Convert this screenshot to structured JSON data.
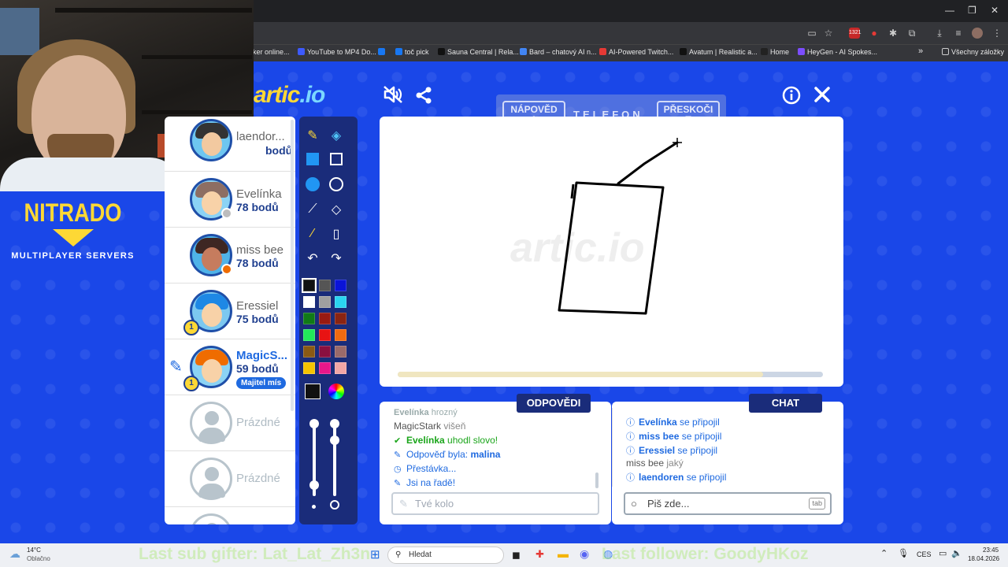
{
  "browser": {
    "bookmarks": [
      {
        "label": "aker online...",
        "color": "#ffffff"
      },
      {
        "label": "YouTube to MP4 Do...",
        "color": "#3d5afe"
      },
      {
        "label": "",
        "color": "#1877f2"
      },
      {
        "label": "toč pick",
        "color": "#1877f2"
      },
      {
        "label": "Sauna Central | Rela...",
        "color": "#111111"
      },
      {
        "label": "Bard – chatový AI n...",
        "color": "#4285f4"
      },
      {
        "label": "AI-Powered Twitch...",
        "color": "#e53935"
      },
      {
        "label": "Avatum | Realistic a...",
        "color": "#111111"
      },
      {
        "label": "Home",
        "color": "#222222"
      },
      {
        "label": "HeyGen - AI Spokes...",
        "color": "#7c4dff"
      }
    ],
    "all_bookmarks": "Všechny záložky",
    "more": "»"
  },
  "logo": {
    "main": "artic",
    "suffix": ".io"
  },
  "sponsor": {
    "title": "NITRADO",
    "subtitle": "MULTIPLAYER SERVERS"
  },
  "hints": {
    "hint_label": "NÁPOVĚD",
    "hint_key": "A",
    "word": "TELEFON",
    "skip_label": "PŘESKOČI",
    "skip_key": "T"
  },
  "players": [
    {
      "name": "laendor...",
      "points": "bodů",
      "hair": "#333",
      "skin": "#f2c9a0",
      "bg": "#6ec6f0"
    },
    {
      "name": "Evelínka",
      "points": "78 bodů",
      "hair": "#8d6e63",
      "skin": "#f8d2a8",
      "bg": "#8bd3f5",
      "dot": "#bdbdbd"
    },
    {
      "name": "miss bee",
      "points": "78 bodů",
      "hair": "#3e2723",
      "skin": "#c67c5e",
      "bg": "#4fb3e8",
      "dot": "#ef6c00"
    },
    {
      "name": "Eressiel",
      "points": "75 bodů",
      "hair": "#1e88e5",
      "skin": "#f8d2a8",
      "bg": "#7cc8f0",
      "trophy": "1"
    },
    {
      "name": "MagicS...",
      "points": "59 bodů",
      "hair": "#ef6c00",
      "skin": "#f8d2a8",
      "bg": "#8bd3f5",
      "trophy": "1",
      "badge": "Majitel mís"
    },
    {
      "name": "Prázdné"
    },
    {
      "name": "Prázdné"
    }
  ],
  "palette": [
    "#111111",
    "#555555",
    "#0a14d8",
    "#ffffff",
    "#a0a0a0",
    "#2ad4f0",
    "#117a17",
    "#991a11",
    "#8a2412",
    "#22e85a",
    "#e81313",
    "#f06a10",
    "#8a5a14",
    "#8a1040",
    "#9a6a6a",
    "#f5c400",
    "#e8178a",
    "#f2a6a6"
  ],
  "answers": {
    "tab": "ODPOVĚDI",
    "messages": [
      {
        "user": "Evelínka",
        "text": "hrozný"
      },
      {
        "user": "MagicStark",
        "text": "višeň"
      },
      {
        "icon": "✔",
        "user": "Evelínka",
        "text": "uhodl slovo!",
        "color": "#1aa51a"
      },
      {
        "icon": "✎",
        "text": "Odpověď byla:",
        "extra": "malina",
        "color": "#1f6ae0"
      },
      {
        "icon": "◷",
        "text": "Přestávka...",
        "color": "#1f6ae0"
      },
      {
        "icon": "✎",
        "text": "Jsi na řadě!",
        "color": "#1f6ae0"
      }
    ],
    "placeholder": "Tvé kolo"
  },
  "chat": {
    "tab": "CHAT",
    "messages": [
      {
        "icon": "ⓘ",
        "user": "Evelínka",
        "text": "se připojil"
      },
      {
        "icon": "ⓘ",
        "user": "miss bee",
        "text": "se připojil"
      },
      {
        "icon": "ⓘ",
        "user": "Eressiel",
        "text": "se připojil"
      },
      {
        "user": "miss bee",
        "text": "jaký",
        "plain": true
      },
      {
        "icon": "ⓘ",
        "user": "laendoren",
        "text": "se připojil"
      }
    ],
    "placeholder": "Piš zde...",
    "tab_key": "tab"
  },
  "taskbar": {
    "weather_temp": "14°C",
    "weather_desc": "Oblačno",
    "search": "Hledat",
    "lang": "CES",
    "time": "23:45",
    "date": "18.04.2026",
    "overlay_left": "Last sub gifter: Lat_Lat_Zh3n",
    "overlay_right": "Last follower: GoodyHKoz"
  },
  "canvas_drawing": {
    "description_free": true
  }
}
